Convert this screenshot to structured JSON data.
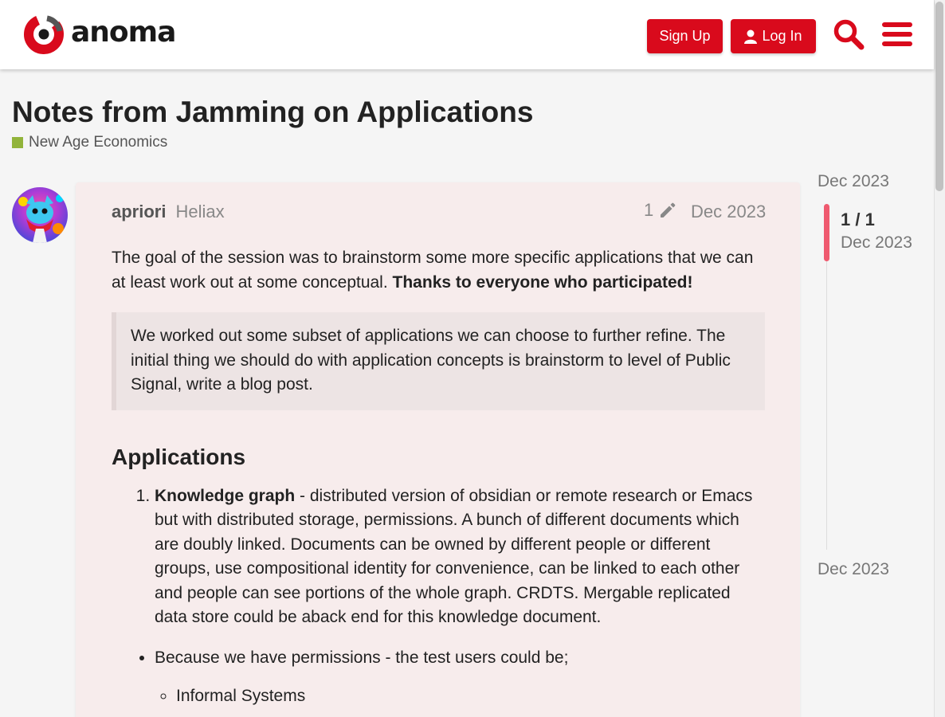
{
  "header": {
    "logo_text": "anoma",
    "signup_label": "Sign Up",
    "login_label": "Log In",
    "search_icon": "search-icon",
    "menu_icon": "hamburger-menu-icon",
    "accent_color": "#d90a1c"
  },
  "topic": {
    "title": "Notes from Jamming on Applications",
    "category": "New Age Economics",
    "category_color": "#92b43b"
  },
  "post": {
    "username": "apriori",
    "user_title": "Heliax",
    "edit_count": "1",
    "date": "Dec 2023",
    "intro": "The goal of the session was to brainstorm some more specific applications that we can at least work out at some conceptual. ",
    "intro_bold": "Thanks to everyone who participated!",
    "quote": "We worked out some subset of applications we can choose to further refine. The initial thing we should do with application concepts is brainstorm to level of Public Signal, write a blog post.",
    "heading": "Applications",
    "list_item_1_bold": "Knowledge graph",
    "list_item_1_text": " - distributed version of obsidian or remote research or Emacs but with distributed storage, permissions. A bunch of different documents which are doubly linked. Documents can be owned by different people or different groups, use compositional identity for convenience, can be linked to each other and people can see portions of the whole graph. CRDTS. Mergable replicated data store could be aback end for this knowledge document.",
    "bullet_1": "Because we have permissions - the test users could be;",
    "sub_bullet_1": "Informal Systems"
  },
  "timeline": {
    "start_date": "Dec 2023",
    "position": "1 / 1",
    "position_date": "Dec 2023",
    "end_date": "Dec 2023",
    "progress_color": "#ef5a6f"
  }
}
